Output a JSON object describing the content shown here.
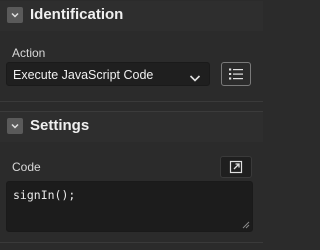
{
  "sections": {
    "identification": {
      "title": "Identification",
      "icon": "chevron-down-icon"
    },
    "settings": {
      "title": "Settings",
      "icon": "chevron-down-icon"
    }
  },
  "action": {
    "label": "Action",
    "value": "Execute JavaScript Code",
    "dropdown_icon": "chevron-down-icon",
    "list_button_icon": "list-icon"
  },
  "code": {
    "label": "Code",
    "value": "signIn();",
    "expand_icon": "expand-icon"
  },
  "colors": {
    "background": "#2b2b2b",
    "field_background": "#1f1f1f",
    "text": "#e6e6e6"
  }
}
